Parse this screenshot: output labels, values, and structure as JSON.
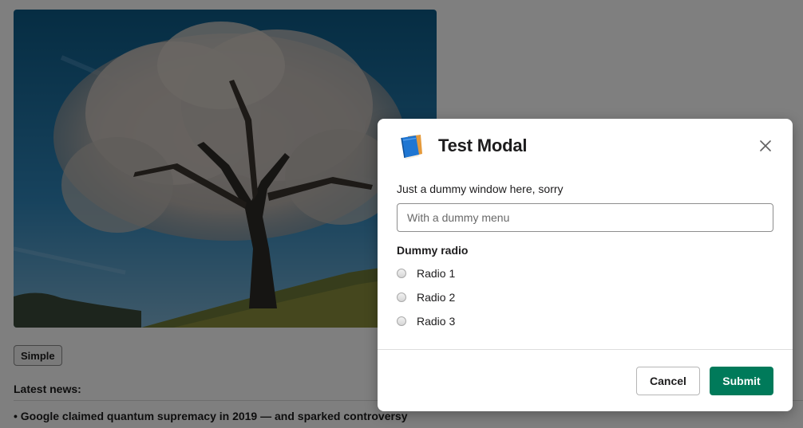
{
  "background": {
    "simple_button_label": "Simple",
    "news_header": "Latest news:",
    "news_item": "• Google claimed quantum supremacy in 2019 — and sparked controversy"
  },
  "modal": {
    "icon": "book-icon",
    "title": "Test Modal",
    "body_text": "Just a dummy window here, sorry",
    "menu_placeholder": "With a dummy menu",
    "radio_group_label": "Dummy radio",
    "radio_options": [
      "Radio 1",
      "Radio 2",
      "Radio 3"
    ],
    "cancel_label": "Cancel",
    "submit_label": "Submit"
  },
  "colors": {
    "submit_bg": "#007a5a",
    "overlay": "rgba(0,0,0,0.5)"
  }
}
